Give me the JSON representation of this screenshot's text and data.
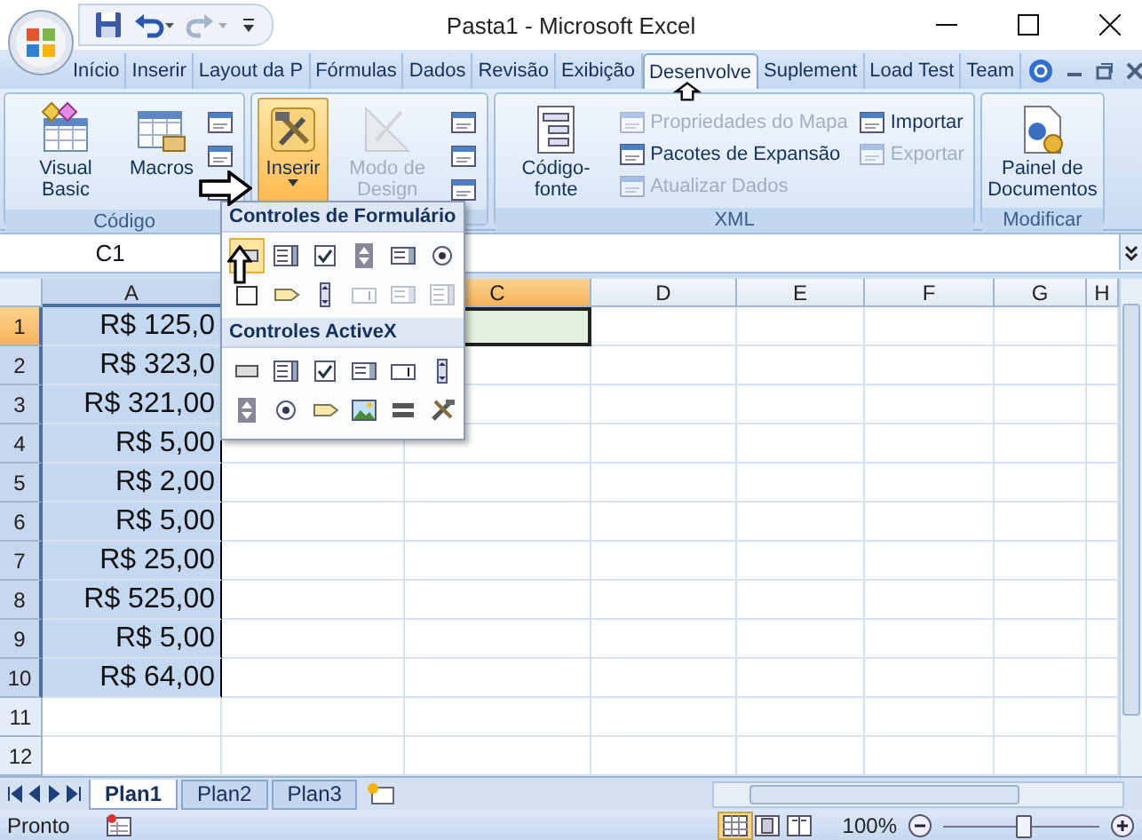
{
  "window": {
    "title": "Pasta1 - Microsoft Excel"
  },
  "tabs": [
    {
      "label": "Início",
      "selected": false
    },
    {
      "label": "Inserir",
      "selected": false
    },
    {
      "label": "Layout da P",
      "selected": false
    },
    {
      "label": "Fórmulas",
      "selected": false
    },
    {
      "label": "Dados",
      "selected": false
    },
    {
      "label": "Revisão",
      "selected": false
    },
    {
      "label": "Exibição",
      "selected": false
    },
    {
      "label": "Desenvolve",
      "selected": true
    },
    {
      "label": "Suplement",
      "selected": false
    },
    {
      "label": "Load Test",
      "selected": false
    },
    {
      "label": "Team",
      "selected": false
    }
  ],
  "ribbon": {
    "groups": [
      {
        "label": "Código",
        "items": [
          {
            "kind": "large",
            "label": "Visual Basic",
            "disabled": false,
            "pressed": false
          },
          {
            "kind": "large",
            "label": "Macros",
            "disabled": false,
            "pressed": false
          },
          {
            "kind": "stack",
            "items": [
              {
                "disabled": false
              },
              {
                "disabled": false
              },
              {
                "disabled": false
              }
            ]
          }
        ]
      },
      {
        "items": [
          {
            "kind": "large",
            "label": "Inserir",
            "disabled": false,
            "pressed": true
          },
          {
            "kind": "large",
            "label": "Modo de Design",
            "disabled": true,
            "pressed": false
          },
          {
            "kind": "stack",
            "items": [
              {
                "disabled": false
              },
              {
                "disabled": false
              },
              {
                "disabled": false
              }
            ]
          }
        ]
      },
      {
        "label": "XML",
        "items": [
          {
            "kind": "large",
            "label": "Código-fonte",
            "disabled": false,
            "pressed": false
          },
          {
            "kind": "stack",
            "items": [
              {
                "label": "Propriedades do Mapa",
                "disabled": true
              },
              {
                "label": "Pacotes de Expansão",
                "disabled": false
              },
              {
                "label": "Atualizar Dados",
                "disabled": true
              }
            ]
          },
          {
            "kind": "stack",
            "items": [
              {
                "label": "Importar",
                "disabled": false
              },
              {
                "label": "Exportar",
                "disabled": true
              }
            ]
          }
        ]
      },
      {
        "label": "Modificar",
        "items": [
          {
            "kind": "large",
            "label": "Painel de Documentos",
            "disabled": false,
            "pressed": false
          }
        ]
      }
    ]
  },
  "insert_menu": {
    "sections": [
      {
        "title": "Controles de Formulário",
        "controls": [
          {
            "selected": true,
            "disabled": false
          },
          {
            "selected": false,
            "disabled": false
          },
          {
            "selected": false,
            "disabled": false
          },
          {
            "selected": false,
            "disabled": false
          },
          {
            "selected": false,
            "disabled": false
          },
          {
            "selected": false,
            "disabled": false
          },
          {
            "selected": false,
            "disabled": false
          },
          {
            "selected": false,
            "disabled": false
          },
          {
            "selected": false,
            "disabled": false
          },
          {
            "selected": false,
            "disabled": true
          },
          {
            "selected": false,
            "disabled": true
          },
          {
            "selected": false,
            "disabled": true
          }
        ]
      },
      {
        "title": "Controles ActiveX",
        "controls": [
          {
            "selected": false,
            "disabled": false
          },
          {
            "selected": false,
            "disabled": false
          },
          {
            "selected": false,
            "disabled": false
          },
          {
            "selected": false,
            "disabled": false
          },
          {
            "selected": false,
            "disabled": false
          },
          {
            "selected": false,
            "disabled": false
          },
          {
            "selected": false,
            "disabled": false
          },
          {
            "selected": false,
            "disabled": false
          },
          {
            "selected": false,
            "disabled": false
          },
          {
            "selected": false,
            "disabled": false
          },
          {
            "selected": false,
            "disabled": false
          },
          {
            "selected": false,
            "disabled": false
          }
        ]
      }
    ]
  },
  "formula_bar": {
    "name_box": "C1"
  },
  "sheet": {
    "columns": [
      {
        "label": "A",
        "selected": true,
        "active": false
      },
      {},
      {
        "label": "C",
        "selected": false,
        "active": true
      },
      {
        "label": "D",
        "selected": false,
        "active": false
      },
      {
        "label": "E",
        "selected": false,
        "active": false
      },
      {
        "label": "F",
        "selected": false,
        "active": false
      },
      {
        "label": "G",
        "selected": false,
        "active": false
      },
      {
        "label": "H",
        "selected": false,
        "active": false
      }
    ],
    "rows": [
      {
        "number": "1",
        "selected": true,
        "active": true,
        "cells": [
          "R$ 125,0"
        ]
      },
      {
        "number": "2",
        "selected": true,
        "active": false,
        "cells": [
          "R$ 323,0"
        ]
      },
      {
        "number": "3",
        "selected": true,
        "active": false,
        "cells": [
          "R$ 321,00"
        ]
      },
      {
        "number": "4",
        "selected": true,
        "active": false,
        "cells": [
          "R$ 5,00"
        ]
      },
      {
        "number": "5",
        "selected": true,
        "active": false,
        "cells": [
          "R$ 2,00"
        ]
      },
      {
        "number": "6",
        "selected": true,
        "active": false,
        "cells": [
          "R$ 5,00"
        ]
      },
      {
        "number": "7",
        "selected": true,
        "active": false,
        "cells": [
          "R$ 25,00"
        ]
      },
      {
        "number": "8",
        "selected": true,
        "active": false,
        "cells": [
          "R$ 525,00"
        ]
      },
      {
        "number": "9",
        "selected": true,
        "active": false,
        "cells": [
          "R$ 5,00"
        ]
      },
      {
        "number": "10",
        "selected": true,
        "active": false,
        "cells": [
          "R$ 64,00"
        ]
      },
      {
        "number": "11",
        "selected": false,
        "active": false,
        "cells": []
      },
      {
        "number": "12",
        "selected": false,
        "active": false,
        "cells": []
      }
    ]
  },
  "sheet_tabs": [
    {
      "label": "Plan1",
      "selected": true
    },
    {
      "label": "Plan2",
      "selected": false
    },
    {
      "label": "Plan3",
      "selected": false
    }
  ],
  "status_bar": {
    "text": "Pronto",
    "views": [
      {
        "selected": true
      },
      {
        "selected": false
      },
      {
        "selected": false
      }
    ],
    "zoom": "100%",
    "zoom_slider": {
      "level": 0.5
    }
  }
}
